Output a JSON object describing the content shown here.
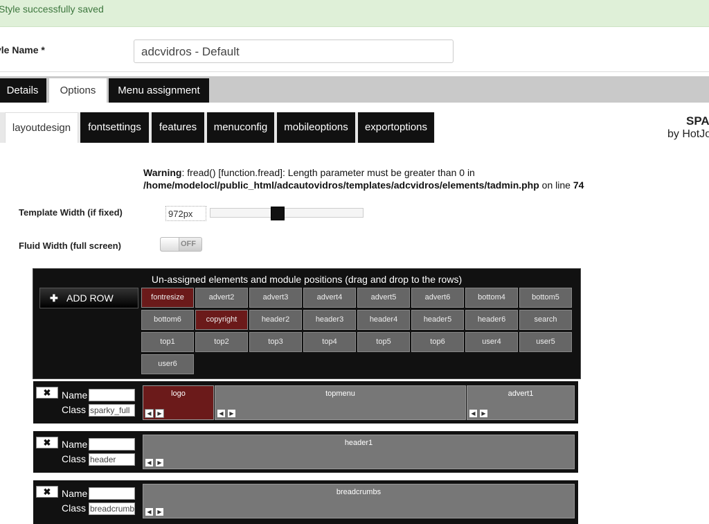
{
  "message": "Style successfully saved",
  "style_name": {
    "label": "yle Name *",
    "value": "adcvidros - Default"
  },
  "main_tabs": [
    "Details",
    "Options",
    "Menu assignment"
  ],
  "sub_tabs": [
    "layoutdesign",
    "fontsettings",
    "features",
    "menuconfig",
    "mobileoptions",
    "exportoptions"
  ],
  "brand": {
    "line1": "SPARKY",
    "line2": "by HotJoomla"
  },
  "warning": {
    "label": "Warning",
    "text": ": fread() [function.fread]: Length parameter must be greater than 0 in",
    "path": "/home/modelocl/public_html/adcautovidros/templates/adcvidros/elements/tadmin.php",
    "on_line": " on line ",
    "line": "74"
  },
  "template_width": {
    "label": "Template Width (if fixed)",
    "value": "972px",
    "slider_fraction": 0.44
  },
  "fluid_width": {
    "label": "Fluid Width (full screen)",
    "toggle": "OFF"
  },
  "unassigned": {
    "title": "Un-assigned elements and module positions (drag and drop to the rows)",
    "add_row": "ADD ROW",
    "chips": [
      {
        "label": "fontresize",
        "red": true
      },
      {
        "label": "advert2"
      },
      {
        "label": "advert3"
      },
      {
        "label": "advert4"
      },
      {
        "label": "advert5"
      },
      {
        "label": "advert6"
      },
      {
        "label": "bottom4"
      },
      {
        "label": "bottom5"
      },
      {
        "label": "bottom6"
      },
      {
        "label": "copyright",
        "red": true
      },
      {
        "label": "header2"
      },
      {
        "label": "header3"
      },
      {
        "label": "header4"
      },
      {
        "label": "header5"
      },
      {
        "label": "header6"
      },
      {
        "label": "search"
      },
      {
        "label": "top1"
      },
      {
        "label": "top2"
      },
      {
        "label": "top3"
      },
      {
        "label": "top4"
      },
      {
        "label": "top5"
      },
      {
        "label": "top6"
      },
      {
        "label": "user4"
      },
      {
        "label": "user5"
      },
      {
        "label": "user6"
      }
    ]
  },
  "rows": [
    {
      "name_label": "Name",
      "class_label": "Class",
      "name_value": "",
      "class_value": "sparky_full",
      "cells": [
        {
          "label": "logo",
          "red": true
        },
        {
          "label": "topmenu"
        },
        {
          "label": "advert1"
        }
      ]
    },
    {
      "name_label": "Name",
      "class_label": "Class",
      "name_value": "",
      "class_value": "header",
      "cells": [
        {
          "label": "header1"
        }
      ]
    },
    {
      "name_label": "Name",
      "class_label": "Class",
      "name_value": "",
      "class_value": "breadcrumbs",
      "cells": [
        {
          "label": "breadcrumbs"
        }
      ]
    }
  ]
}
